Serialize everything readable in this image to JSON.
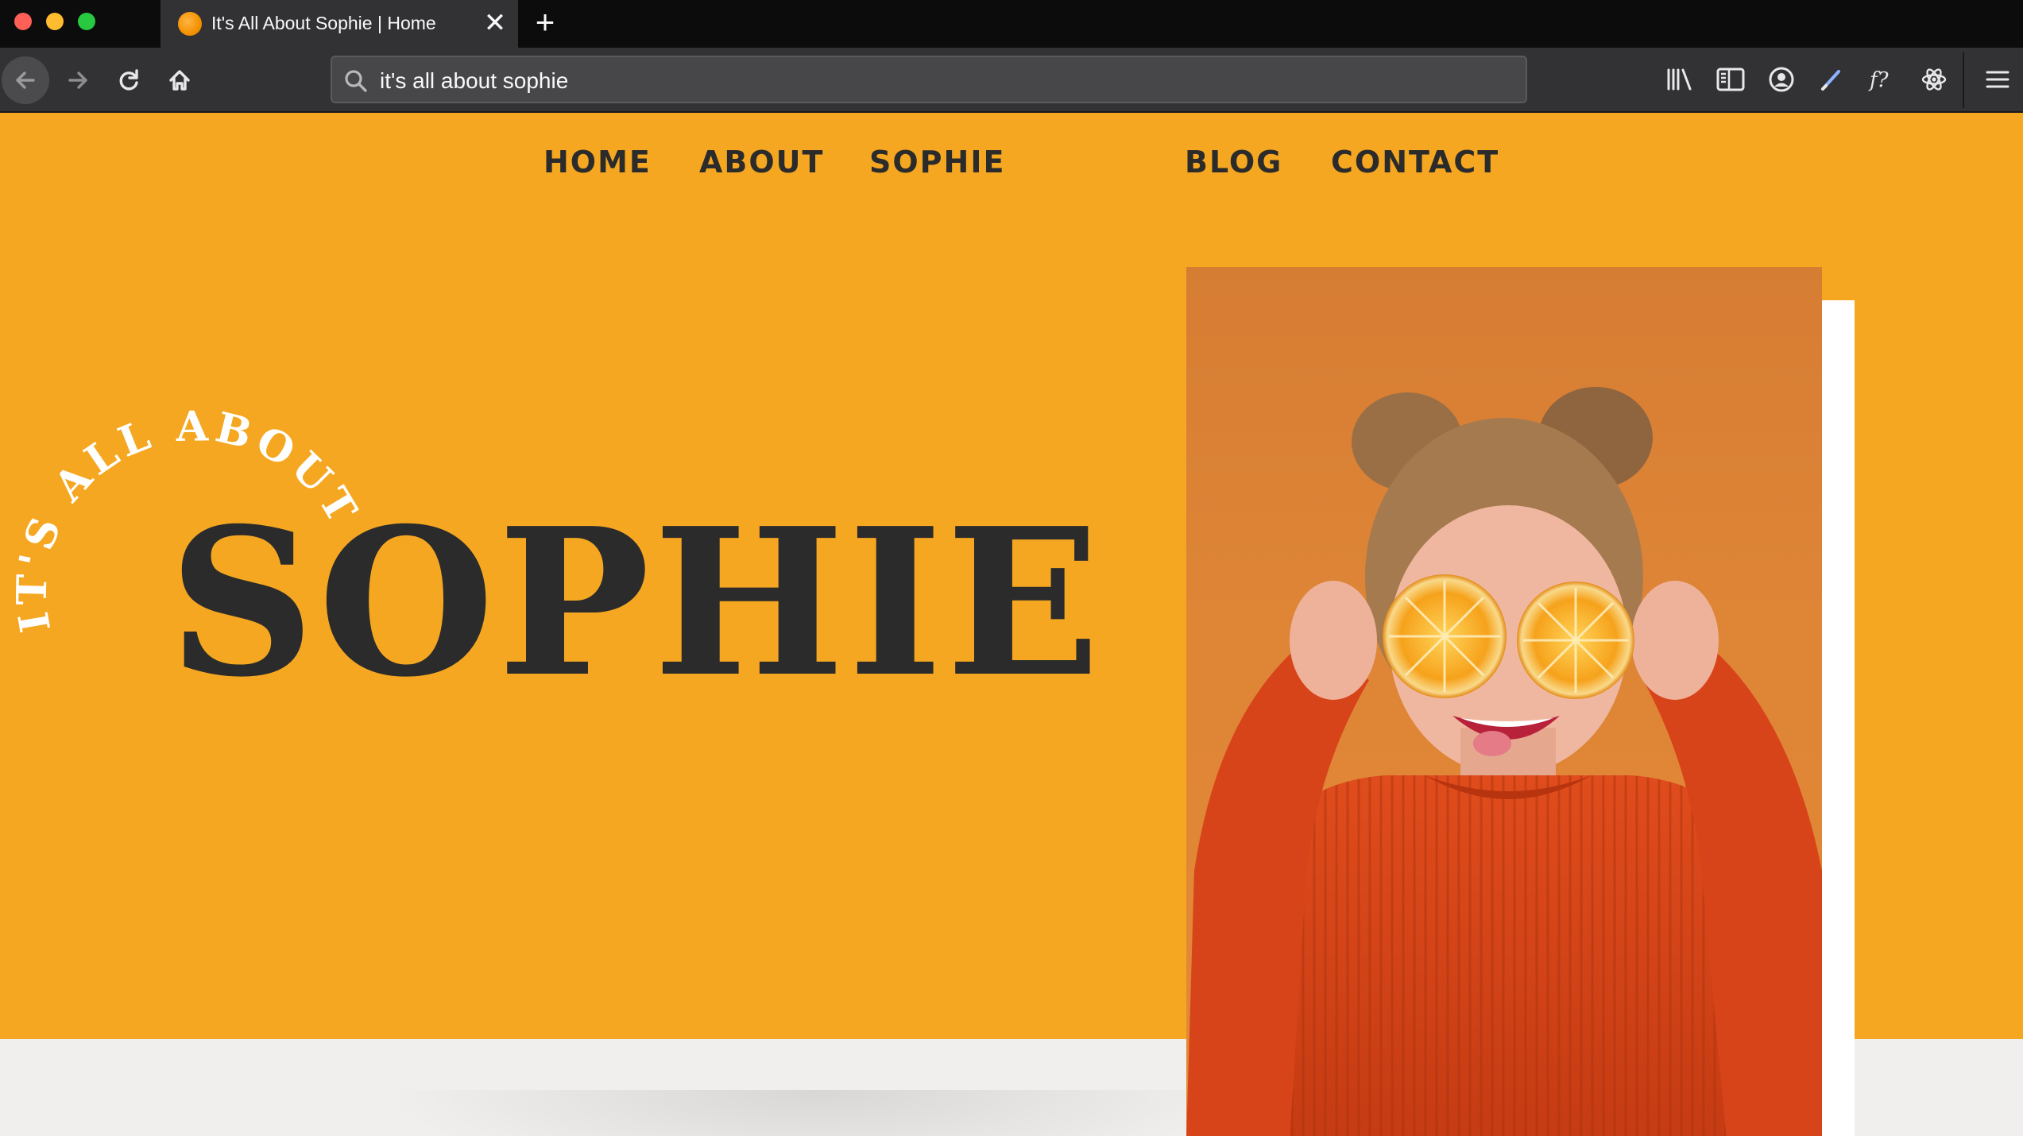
{
  "browser": {
    "tab_title": "It's All About Sophie | Home",
    "close_glyph": "✕",
    "new_tab_glyph": "+",
    "url_text": "it's all about sophie",
    "toolbar_icons": [
      "library-icon",
      "sidebar-icon",
      "account-icon",
      "pen-icon",
      "font-finder-icon",
      "react-devtools-icon",
      "menu-icon"
    ]
  },
  "site": {
    "nav": {
      "home": "HOME",
      "about": "ABOUT",
      "logo": "SOPHIE",
      "blog": "BLOG",
      "contact": "CONTACT"
    },
    "hero": {
      "kicker": "IT'S ALL ABOUT",
      "title": "SOPHIE"
    }
  },
  "colors": {
    "accent_orange": "#f5a721",
    "text_dark": "#2b2b2b",
    "page_light": "#f1efee",
    "photo_bg": "#d67d34",
    "sweater": "#d9451a"
  }
}
